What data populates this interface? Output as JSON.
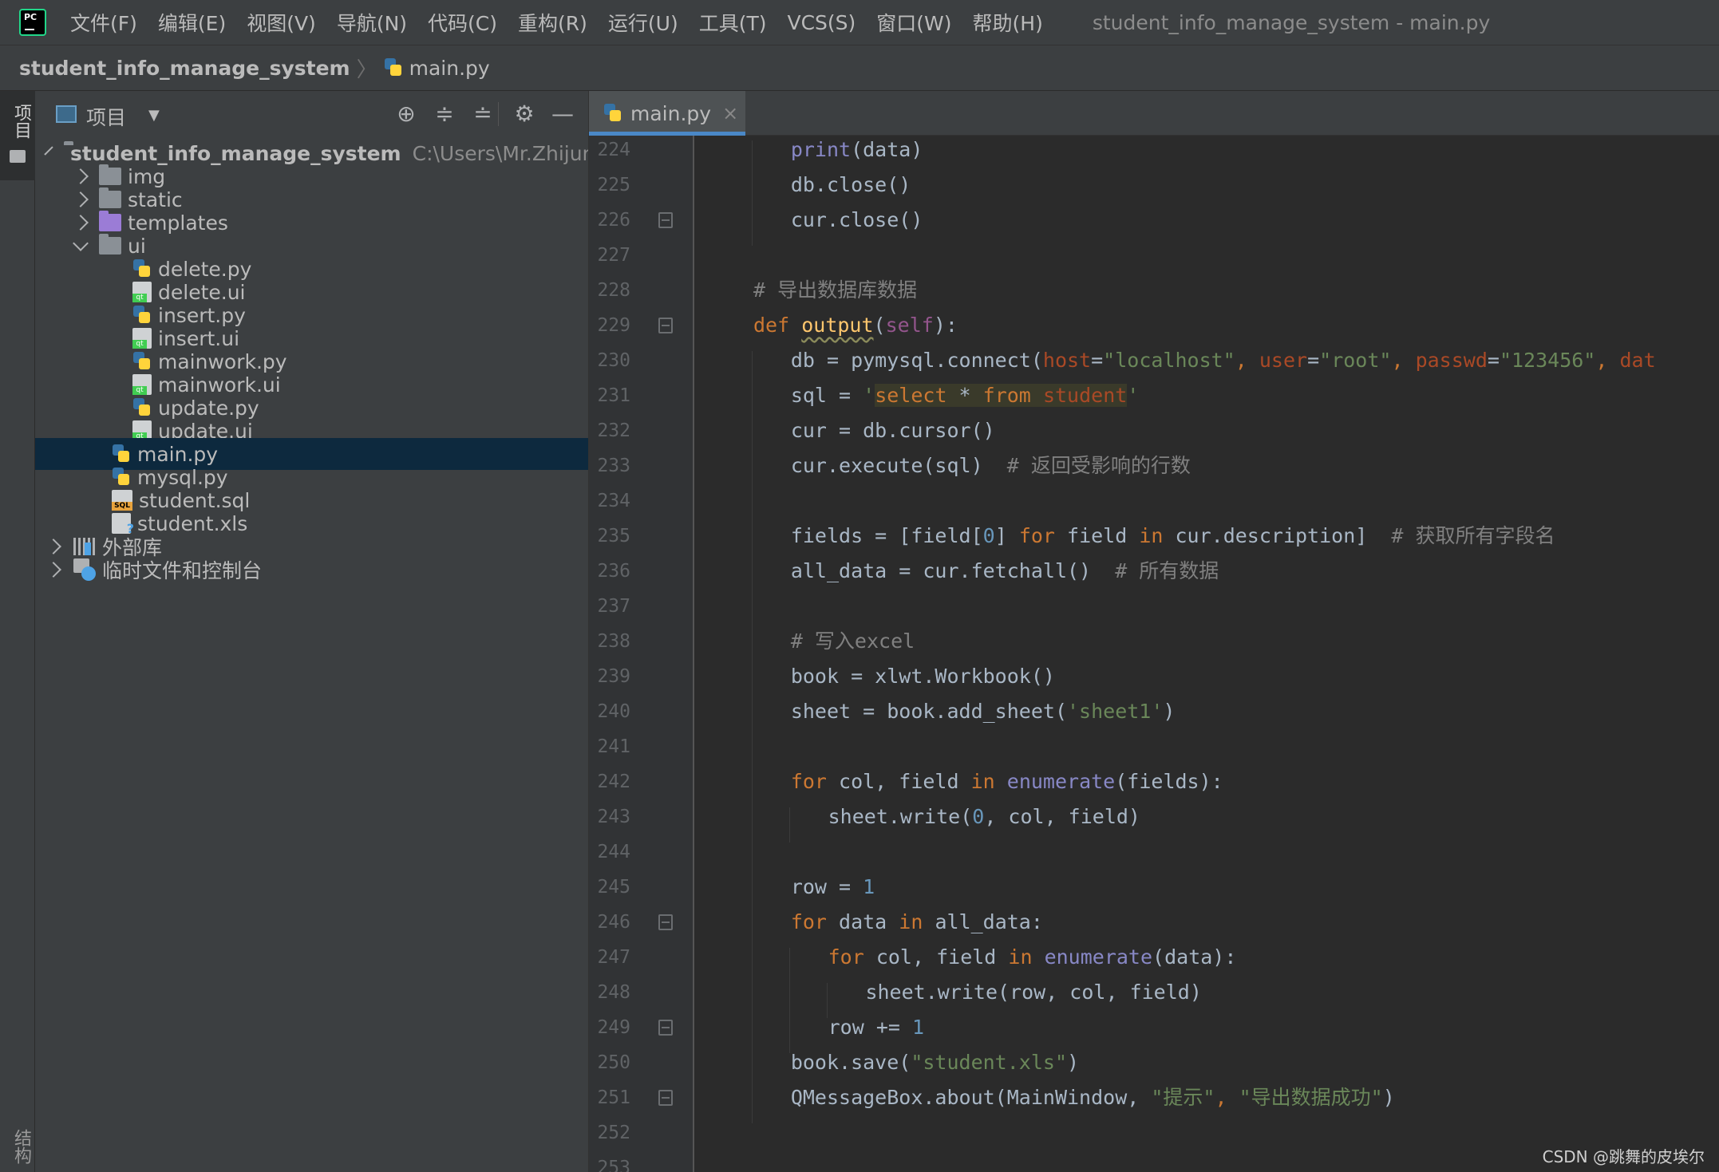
{
  "menubar": {
    "items": [
      "文件(F)",
      "编辑(E)",
      "视图(V)",
      "导航(N)",
      "代码(C)",
      "重构(R)",
      "运行(U)",
      "工具(T)",
      "VCS(S)",
      "窗口(W)",
      "帮助(H)"
    ],
    "window_title": "student_info_manage_system - main.py"
  },
  "breadcrumb": {
    "project": "student_info_manage_system",
    "file": "main.py"
  },
  "tool_strip": {
    "project_label": "项目",
    "structure_label": "结构"
  },
  "project_panel": {
    "title": "项目",
    "tree": [
      {
        "label": "student_info_manage_system",
        "path": "C:\\Users\\Mr.Zhijun\\D",
        "icon": "folder-icon",
        "expanded": true
      },
      {
        "label": "img",
        "icon": "folder-icon",
        "expanded": false
      },
      {
        "label": "static",
        "icon": "folder-icon",
        "expanded": false
      },
      {
        "label": "templates",
        "icon": "folder-purple-icon",
        "expanded": false
      },
      {
        "label": "ui",
        "icon": "folder-icon",
        "expanded": true
      },
      {
        "label": "delete.py",
        "icon": "python-file-icon"
      },
      {
        "label": "delete.ui",
        "icon": "qt-ui-file-icon"
      },
      {
        "label": "insert.py",
        "icon": "python-file-icon"
      },
      {
        "label": "insert.ui",
        "icon": "qt-ui-file-icon"
      },
      {
        "label": "mainwork.py",
        "icon": "python-file-icon"
      },
      {
        "label": "mainwork.ui",
        "icon": "qt-ui-file-icon"
      },
      {
        "label": "update.py",
        "icon": "python-file-icon"
      },
      {
        "label": "update.ui",
        "icon": "qt-ui-file-icon"
      },
      {
        "label": "main.py",
        "icon": "python-file-icon",
        "selected": true
      },
      {
        "label": "mysql.py",
        "icon": "python-file-icon"
      },
      {
        "label": "student.sql",
        "icon": "sql-file-icon"
      },
      {
        "label": "student.xls",
        "icon": "unknown-file-icon"
      },
      {
        "label": "外部库",
        "icon": "library-icon",
        "expanded": false
      },
      {
        "label": "临时文件和控制台",
        "icon": "scratch-icon",
        "expanded": false
      }
    ]
  },
  "editor": {
    "tab_label": "main.py",
    "line_numbers": [
      "224",
      "225",
      "226",
      "227",
      "228",
      "229",
      "230",
      "231",
      "232",
      "233",
      "234",
      "235",
      "236",
      "237",
      "238",
      "239",
      "240",
      "241",
      "242",
      "243",
      "244",
      "245",
      "246",
      "247",
      "248",
      "249",
      "250",
      "251",
      "252",
      "253"
    ],
    "code": {
      "l224": "print(data)",
      "l225": "db.close()",
      "l226": "cur.close()",
      "l228": "# 导出数据库数据",
      "l229_def": "def",
      "l229_name": "output",
      "l229_self": "self",
      "l230_a": "db = pymysql.connect(",
      "l230_host_kw": "host",
      "l230_host_val": "\"localhost\"",
      "l230_user_kw": "user",
      "l230_user_val": "\"root\"",
      "l230_pass_kw": "passwd",
      "l230_pass_val": "\"123456\"",
      "l230_db_kw": "dat",
      "l231_a": "sql = ",
      "l231_sel": "select * from ",
      "l231_tbl": "student",
      "l232": "cur = db.cursor()",
      "l233_a": "cur.execute(sql)",
      "l233_cmt": "# 返回受影响的行数",
      "l235_a": "fields = [field[",
      "l235_num": "0",
      "l235_b": "] ",
      "l235_for": "for",
      "l235_c": " field ",
      "l235_in": "in",
      "l235_d": " cur.description]",
      "l235_cmt": "# 获取所有字段名",
      "l236_a": "all_data = cur.fetchall()",
      "l236_cmt": "# 所有数据",
      "l238": "# 写入excel",
      "l239": "book = xlwt.Workbook()",
      "l240_a": "sheet = book.add_sheet(",
      "l240_str": "'sheet1'",
      "l242_for": "for",
      "l242_a": " col, field ",
      "l242_in": "in",
      "l242_fn": "enumerate",
      "l242_b": "(fields):",
      "l243_a": "sheet.write(",
      "l243_num": "0",
      "l243_b": ", col, field)",
      "l245_a": "row = ",
      "l245_num": "1",
      "l246_for": "for",
      "l246_a": " data ",
      "l246_in": "in",
      "l246_b": " all_data:",
      "l247_for": "for",
      "l247_a": " col, field ",
      "l247_in": "in",
      "l247_fn": "enumerate",
      "l247_b": "(data):",
      "l248": "sheet.write(row, col, field)",
      "l249_a": "row += ",
      "l249_num": "1",
      "l250_a": "book.save(",
      "l250_str": "\"student.xls\"",
      "l251_a": "QMessageBox.about(MainWindow, ",
      "l251_s1": "\"提示\"",
      "l251_s2": "\"导出数据成功\""
    }
  },
  "watermark": "CSDN @跳舞的皮埃尔",
  "colors": {
    "editor_bg": "#2b2b2b",
    "panel_bg": "#3c3f41",
    "selection": "#0d293e",
    "keyword": "#cc7832",
    "string": "#6a8759",
    "number": "#6897bb",
    "comment": "#808080",
    "tab_underline": "#4a88c7"
  }
}
